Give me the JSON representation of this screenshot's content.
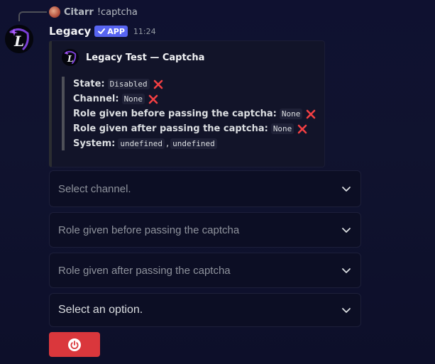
{
  "reply": {
    "author": "Citarr",
    "content": "!captcha"
  },
  "message": {
    "author": "Legacy",
    "badge": "APP",
    "timestamp": "11:24"
  },
  "embed": {
    "title": "Legacy Test — Captcha",
    "fields": [
      {
        "label": "State:",
        "value": "Disabled",
        "status": "x-icon"
      },
      {
        "label": "Channel:",
        "value": "None",
        "status": "x-icon"
      },
      {
        "label": "Role given before passing the captcha:",
        "value": "None",
        "status": "x-icon"
      },
      {
        "label": "Role given after passing the captcha:",
        "value": "None",
        "status": "x-icon"
      },
      {
        "label": "System:",
        "value": "undefined",
        "separator": ",",
        "value2": "undefined"
      }
    ]
  },
  "components": {
    "select_channel": {
      "placeholder": "Select channel."
    },
    "select_role_before": {
      "placeholder": "Role given before passing the captcha"
    },
    "select_role_after": {
      "placeholder": "Role given after passing the captcha"
    },
    "select_option": {
      "placeholder": "Select an option."
    },
    "power_button": {
      "icon": "power-icon",
      "color": "#da373c"
    }
  },
  "colors": {
    "brand": "#5865f2",
    "danger": "#da373c",
    "x_mark": "#f23f43"
  }
}
